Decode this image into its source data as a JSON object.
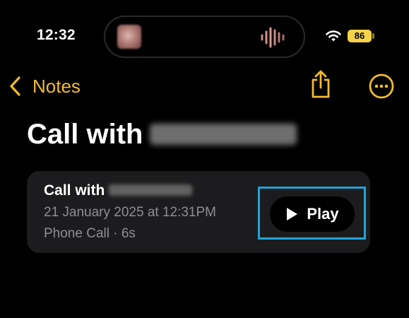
{
  "status_bar": {
    "time": "12:32",
    "battery_level": "86",
    "icons": [
      "album-art-thumbnail",
      "audio-waveform-icon",
      "wifi-icon",
      "battery-icon"
    ]
  },
  "nav": {
    "back_label": "Notes",
    "back_icon": "chevron-left-icon",
    "share_icon": "share-icon",
    "more_icon": "ellipsis-circle-icon",
    "accent_color": "#f2bd2c"
  },
  "note": {
    "title_prefix": "Call with"
  },
  "recording": {
    "title_prefix": "Call with",
    "date": "21 January 2025 at 12:31PM",
    "meta": "Phone Call · 6s",
    "play_label": "Play",
    "play_icon": "play-icon"
  },
  "highlight_color": "#1ea5d8"
}
